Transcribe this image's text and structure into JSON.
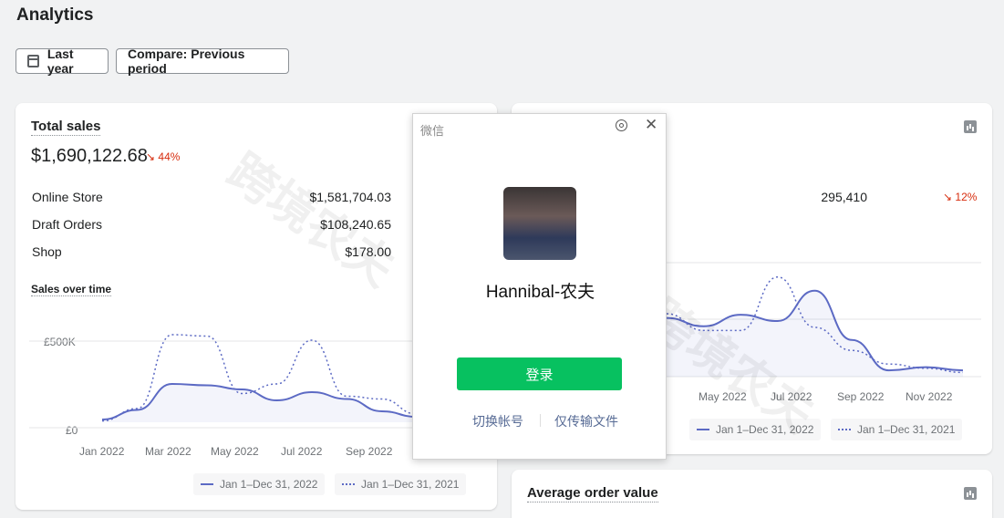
{
  "page": {
    "title": "Analytics"
  },
  "toolbar": {
    "date_label": "Last year",
    "compare_label": "Compare: Previous period"
  },
  "total_sales": {
    "title": "Total sales",
    "value": "$1,690,122.68",
    "change": "44%",
    "change_arrow": "↘",
    "rows": [
      {
        "label": "Online Store",
        "value": "$1,581,704.03"
      },
      {
        "label": "Draft Orders",
        "value": "$108,240.65"
      },
      {
        "label": "Shop",
        "value": "$178.00"
      }
    ],
    "subtitle": "Sales over time",
    "legend_current": "Jan 1–Dec 31, 2022",
    "legend_previous": "Jan 1–Dec 31, 2021"
  },
  "right_card": {
    "row_value": "295,410",
    "change": "12%",
    "change_arrow": "↘",
    "legend_current": "Jan 1–Dec 31, 2022",
    "legend_previous": "Jan 1–Dec 31, 2021"
  },
  "aov": {
    "title": "Average order value"
  },
  "wechat": {
    "title": "微信",
    "name": "Hannibal-农夫",
    "login_label": "登录",
    "switch_label": "切换帐号",
    "transfer_label": "仅传输文件"
  },
  "watermark": {
    "text": "跨境农夫"
  },
  "colors": {
    "accent": "#5c6ac4",
    "decrease": "#d72c0d",
    "wechat_green": "#07c160"
  },
  "chart_data": [
    {
      "type": "line",
      "title": "Sales over time",
      "x_ticks": [
        "Jan 2022",
        "Mar 2022",
        "May 2022",
        "Jul 2022",
        "Sep 2022"
      ],
      "y_ticks": [
        "£0",
        "£500K"
      ],
      "ylim": [
        0,
        800000
      ],
      "series": [
        {
          "name": "Jan 1–Dec 31, 2022",
          "style": "solid",
          "values": [
            20000,
            90000,
            280000,
            270000,
            240000,
            160000,
            220000,
            170000,
            80000,
            40000
          ]
        },
        {
          "name": "Jan 1–Dec 31, 2021",
          "style": "dotted",
          "values": [
            10000,
            100000,
            640000,
            630000,
            210000,
            280000,
            600000,
            190000,
            170000,
            60000
          ]
        }
      ]
    },
    {
      "type": "line",
      "x_ticks": [
        "May 2022",
        "Jul 2022",
        "Sep 2022",
        "Nov 2022"
      ],
      "series": [
        {
          "name": "Jan 1–Dec 31, 2022",
          "style": "solid",
          "values": [
            0.56,
            0.48,
            0.59,
            0.53,
            0.82,
            0.35,
            0.06,
            0.09,
            0.06
          ]
        },
        {
          "name": "Jan 1–Dec 31, 2021",
          "style": "dotted",
          "values": [
            0.6,
            0.44,
            0.44,
            0.95,
            0.47,
            0.25,
            0.12,
            0.08,
            0.04
          ]
        }
      ]
    }
  ]
}
